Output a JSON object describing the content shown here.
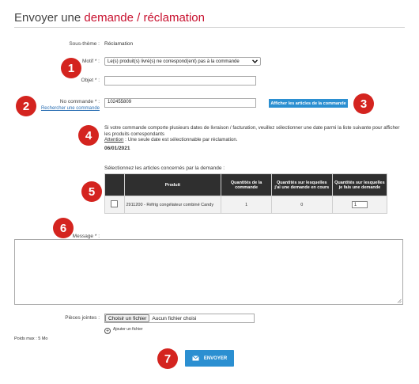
{
  "header": {
    "title_prefix": "Envoyer une",
    "title_highlight": "demande / réclamation"
  },
  "form": {
    "sous_theme_label": "Sous-thème :",
    "sous_theme_value": "Réclamation",
    "motif_label": "Motif * :",
    "motif_value": "Le(s) produit(s) livré(s) ne correspond(ent) pas à la commande",
    "objet_label": "Objet * :",
    "objet_value": "",
    "no_commande_label": "No commande * :",
    "no_commande_value": "102455809",
    "rechercher_link": "Rechercher une commande",
    "afficher_button": "Afficher les articles de la commande",
    "info_text": "Si votre commande comporte plusieurs dates de livraison / facturation, veuillez sélectionner une date parmi la liste suivante pour afficher les produits correspondants",
    "attention_label": "Attention",
    "attention_text": " : Une seule date est sélectionnable par réclamation.",
    "date_value": "06/01/2021",
    "select_articles_label": "Sélectionnez les articles concernés par la demande :",
    "message_label": "Message * :",
    "pieces_jointes_label": "Pièces jointes :",
    "choose_file_button": "Choisir un fichier",
    "no_file_text": "Aucun fichier choisi",
    "ajouter_fichier_label": "Ajouter un fichier",
    "poids_max_label": "Poids max : 5 Mo",
    "send_button": "ENVOYER"
  },
  "table": {
    "headers": [
      "Produit",
      "Quantités de la commande",
      "Quantités sur lesquelles j'ai une demande en cours",
      "Quantités sur lesquelles je fais une demande"
    ],
    "rows": [
      {
        "produit": "2911200 - Réfrig congélateur combiné Candy",
        "qte_commande": "1",
        "qte_en_cours": "0",
        "qte_demande": "1"
      }
    ]
  },
  "badges": [
    "1",
    "2",
    "3",
    "4",
    "5",
    "6",
    "7"
  ],
  "colors": {
    "accent_red": "#c8102e",
    "badge_red": "#d4241f",
    "button_blue": "#2b8fd1",
    "table_header": "#2f2f2f"
  },
  "icons": {
    "select_arrow": "chevron-down-icon",
    "add_file": "plus-circle-icon",
    "send": "envelope-icon"
  }
}
